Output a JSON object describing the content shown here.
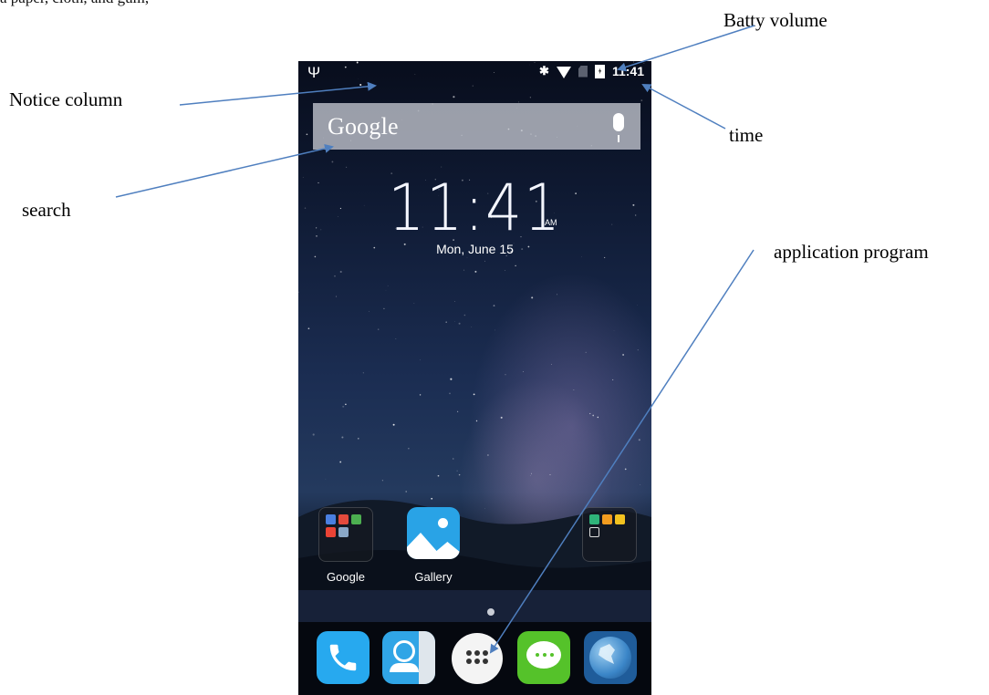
{
  "page": {
    "cut_text": "a paper, cloth, and gum,"
  },
  "annotations": {
    "batty_volume": "Batty volume",
    "notice_column": "Notice column",
    "time": "time",
    "search": "search",
    "application_program": "application program"
  },
  "status_bar": {
    "left_icon": "usb-icon",
    "right_icons": [
      "bluetooth-icon",
      "wifi-icon",
      "sim-icon",
      "battery-icon"
    ],
    "time": "11:41"
  },
  "search_widget": {
    "label": "Google",
    "icon": "mic-icon"
  },
  "clock_widget": {
    "time": "11:41",
    "ampm": "AM",
    "date": "Mon, June 15"
  },
  "home_apps": [
    {
      "label": "Google",
      "type": "folder"
    },
    {
      "label": "Gallery",
      "type": "app"
    },
    {
      "label": "",
      "type": "folder"
    }
  ],
  "dock": [
    {
      "name": "phone",
      "icon": "phone-icon"
    },
    {
      "name": "contacts",
      "icon": "contacts-icon"
    },
    {
      "name": "all-apps",
      "icon": "app-drawer-icon"
    },
    {
      "name": "messaging",
      "icon": "message-icon"
    },
    {
      "name": "browser",
      "icon": "globe-icon"
    }
  ],
  "colors": {
    "arrow": "#4f7fbf",
    "phone_app": "#27a9ef",
    "messaging_app": "#55c22a",
    "gallery_app": "#29a3e6"
  }
}
